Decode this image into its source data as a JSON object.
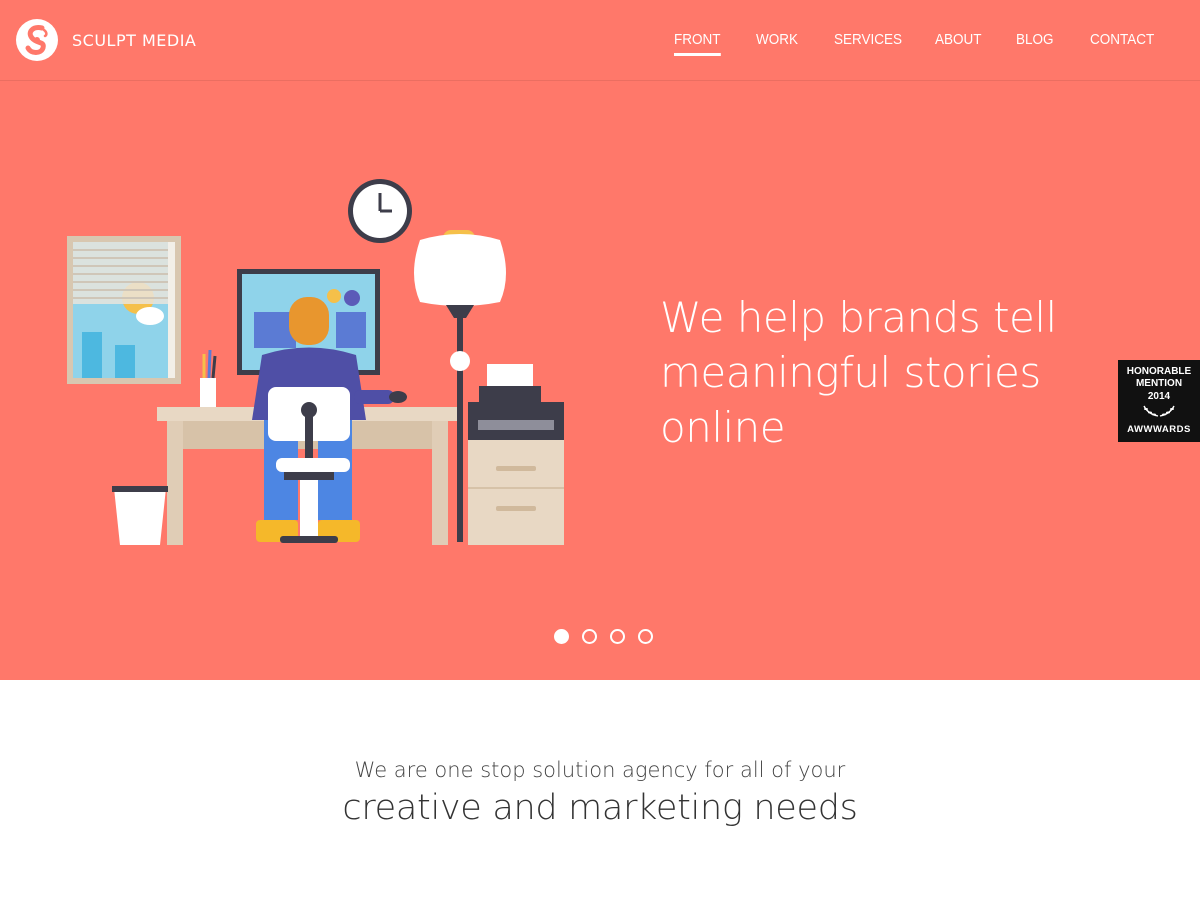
{
  "brand": {
    "name": "SCULPT MEDIA",
    "logo_icon": "s-swirl-logo-icon"
  },
  "nav": {
    "items": [
      {
        "label": "FRONT",
        "active": true
      },
      {
        "label": "WORK",
        "active": false
      },
      {
        "label": "SERVICES",
        "active": false
      },
      {
        "label": "ABOUT",
        "active": false
      },
      {
        "label": "BLOG",
        "active": false
      },
      {
        "label": "CONTACT",
        "active": false
      }
    ]
  },
  "hero": {
    "headline_lines": [
      "We help brands tell",
      "meaningful stories",
      "online"
    ],
    "illustration": "office-worker-at-desk-illustration",
    "slider": {
      "total": 4,
      "active_index": 0
    }
  },
  "award_badge": {
    "line1": "HONORABLE",
    "line2": "MENTION",
    "year": "2014",
    "brand": "AWWWARDS"
  },
  "intro": {
    "line1": "We are one stop solution agency for all of your",
    "line2": "creative and marketing needs"
  },
  "colors": {
    "hero_background": "#ff786a",
    "text_on_hero": "#ffffff",
    "badge_background": "#111111"
  }
}
